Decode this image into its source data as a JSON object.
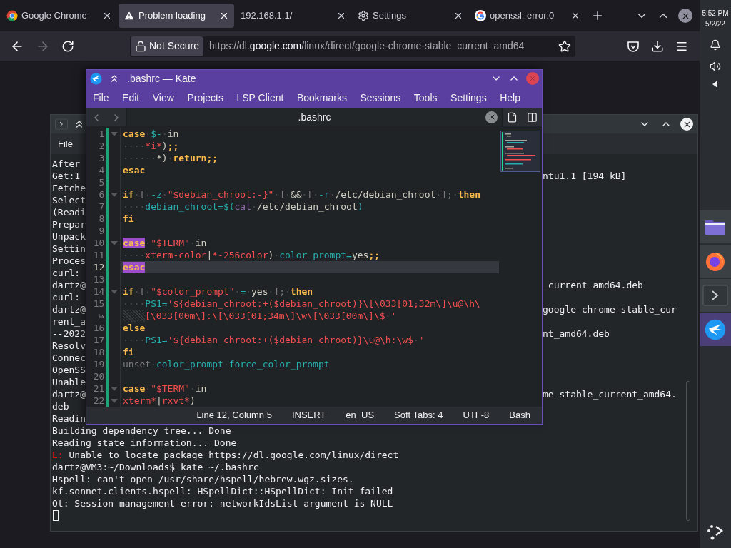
{
  "browser": {
    "tabs": [
      {
        "label": "Google Chrome",
        "kind": "chrome",
        "selected": false
      },
      {
        "label": "Problem loading",
        "kind": "warning",
        "selected": true
      },
      {
        "label": "192.168.1.1/",
        "kind": "plain",
        "selected": false
      },
      {
        "label": "Settings",
        "kind": "gear",
        "selected": false
      },
      {
        "label": "openssl: error:0",
        "kind": "google",
        "selected": false
      }
    ],
    "security": "Not Secure",
    "url": {
      "prefix": "https://dl.",
      "domain": "google.com",
      "rest": "/linux/direct/google-chrome-stable_current_amd64"
    }
  },
  "clock": {
    "time": "5:52 PM",
    "date": "5/2/22"
  },
  "terminal": {
    "menu": [
      "File"
    ],
    "lines": [
      {
        "left": "After"
      },
      {
        "left": "Get:1",
        "right": "ntu1.1 [194 kB]"
      },
      {
        "left": "Fetche"
      },
      {
        "left": "Select"
      },
      {
        "left": "(Readi"
      },
      {
        "left": "Prepar"
      },
      {
        "left": "Unpack"
      },
      {
        "left": "Settin"
      },
      {
        "left": "Proces"
      },
      {
        "left": "curl:"
      },
      {
        "left": "dartz@",
        "right": "_current_amd64.deb"
      },
      {
        "left": "curl:"
      },
      {
        "left": "dartz@",
        "right": "google-chrome-stable_cur"
      },
      {
        "left": "rent_a"
      },
      {
        "left": "--2022",
        "right": "nt_amd64.deb"
      },
      {
        "left": "Resolv"
      },
      {
        "left": "Connec"
      },
      {
        "left": "OpenSS"
      },
      {
        "left": "Unable"
      },
      {
        "left": "dartz@",
        "right": "me-stable_current_amd64."
      },
      {
        "left": "deb"
      },
      {
        "left": "Readin"
      },
      {
        "left": "Building dependency tree... Done"
      },
      {
        "left": "Reading state information... Done"
      },
      {
        "prefix": "E:",
        "left": " Unable to locate package https://dl.google.com/linux/direct"
      },
      {
        "left": "dartz@VM3:~/Downloads$ kate ~/.bashrc"
      },
      {
        "left": "Hspell: can't open /usr/share/hspell/hebrew.wgz.sizes."
      },
      {
        "left": "kf.sonnet.clients.hspell: HSpellDict::HSpellDict: Init failed"
      },
      {
        "left": "Qt: Session management error: networkIdsList argument is NULL"
      }
    ]
  },
  "kate": {
    "title": ".bashrc — Kate",
    "menu": [
      "File",
      "Edit",
      "View",
      "Projects",
      "LSP Client",
      "Bookmarks",
      "Sessions",
      "Tools",
      "Settings",
      "Help"
    ],
    "tab": ".bashrc",
    "lines": [
      {
        "kind": "line",
        "number": "1",
        "fold": true,
        "current": false,
        "tokens": [
          {
            "kind": "kw",
            "text": "case"
          },
          {
            "kind": "ws",
            "text": "·"
          },
          {
            "kind": "var",
            "text": "$-"
          },
          {
            "kind": "ws",
            "text": "·"
          },
          {
            "kind": "plain",
            "text": "in"
          }
        ]
      },
      {
        "kind": "line",
        "number": "2",
        "fold": false,
        "current": false,
        "tokens": [
          {
            "kind": "ws",
            "text": "····"
          },
          {
            "kind": "str",
            "text": "*i*"
          },
          {
            "kind": "plain",
            "text": ")"
          },
          {
            "kind": "kw",
            "text": ";;"
          }
        ]
      },
      {
        "kind": "line",
        "number": "3",
        "fold": false,
        "current": false,
        "tokens": [
          {
            "kind": "ws",
            "text": "······"
          },
          {
            "kind": "plain",
            "text": "*)"
          },
          {
            "kind": "ws",
            "text": "·"
          },
          {
            "kind": "kw",
            "text": "return;;"
          }
        ]
      },
      {
        "kind": "line",
        "number": "4",
        "fold": false,
        "current": false,
        "tokens": [
          {
            "kind": "kw",
            "text": "esac"
          }
        ]
      },
      {
        "kind": "line",
        "number": "5",
        "fold": false,
        "current": false
      },
      {
        "kind": "line",
        "number": "6",
        "fold": true,
        "current": false,
        "tokens": [
          {
            "kind": "kw",
            "text": "if"
          },
          {
            "kind": "ws",
            "text": "·"
          },
          {
            "kind": "dim",
            "text": "["
          },
          {
            "kind": "ws",
            "text": "·"
          },
          {
            "kind": "var",
            "text": "-z"
          },
          {
            "kind": "ws",
            "text": "·"
          },
          {
            "kind": "str",
            "text": "\"$debian_chroot:-}\""
          },
          {
            "kind": "ws",
            "text": "·"
          },
          {
            "kind": "dim",
            "text": "]"
          },
          {
            "kind": "ws",
            "text": "·"
          },
          {
            "kind": "plain",
            "text": "&&"
          },
          {
            "kind": "ws",
            "text": "·"
          },
          {
            "kind": "dim",
            "text": "["
          },
          {
            "kind": "ws",
            "text": "·"
          },
          {
            "kind": "var",
            "text": "-r"
          },
          {
            "kind": "ws",
            "text": "·"
          },
          {
            "kind": "plain",
            "text": "/etc/debian_chroot"
          },
          {
            "kind": "ws",
            "text": "·"
          },
          {
            "kind": "dim",
            "text": "];"
          },
          {
            "kind": "ws",
            "text": "·"
          },
          {
            "kind": "kw",
            "text": "then"
          }
        ]
      },
      {
        "kind": "line",
        "number": "7",
        "fold": false,
        "current": false,
        "tokens": [
          {
            "kind": "ws",
            "text": "····"
          },
          {
            "kind": "var",
            "text": "debian_chroot=$("
          },
          {
            "kind": "builtin",
            "text": "cat"
          },
          {
            "kind": "ws",
            "text": "·"
          },
          {
            "kind": "plain",
            "text": "/etc/debian_chroot"
          },
          {
            "kind": "var",
            "text": ")"
          }
        ]
      },
      {
        "kind": "line",
        "number": "8",
        "fold": false,
        "current": false,
        "tokens": [
          {
            "kind": "kw",
            "text": "fi"
          }
        ]
      },
      {
        "kind": "line",
        "number": "9",
        "fold": false,
        "current": false
      },
      {
        "kind": "line",
        "number": "10",
        "fold": true,
        "current": false,
        "tokens": [
          {
            "kind": "match",
            "text": "case"
          },
          {
            "kind": "ws",
            "text": "·"
          },
          {
            "kind": "str",
            "text": "\"$TERM\""
          },
          {
            "kind": "ws",
            "text": "·"
          },
          {
            "kind": "plain",
            "text": "in"
          }
        ]
      },
      {
        "kind": "line",
        "number": "11",
        "fold": false,
        "current": false,
        "tokens": [
          {
            "kind": "ws",
            "text": "····"
          },
          {
            "kind": "str",
            "text": "xterm-color"
          },
          {
            "kind": "plain",
            "text": "|"
          },
          {
            "kind": "str",
            "text": "*-256color"
          },
          {
            "kind": "plain",
            "text": ")"
          },
          {
            "kind": "ws",
            "text": "·"
          },
          {
            "kind": "var",
            "text": "color_prompt="
          },
          {
            "kind": "plain",
            "text": "yes"
          },
          {
            "kind": "kw",
            "text": ";;"
          }
        ]
      },
      {
        "kind": "line",
        "number": "12",
        "fold": false,
        "current": true,
        "tokens": [
          {
            "kind": "match",
            "text": "esac"
          }
        ]
      },
      {
        "kind": "line",
        "number": "13",
        "fold": false,
        "current": false
      },
      {
        "kind": "line",
        "number": "14",
        "fold": true,
        "current": false,
        "tokens": [
          {
            "kind": "kw",
            "text": "if"
          },
          {
            "kind": "ws",
            "text": "·"
          },
          {
            "kind": "dim",
            "text": "["
          },
          {
            "kind": "ws",
            "text": "·"
          },
          {
            "kind": "str",
            "text": "\"$color_prompt\""
          },
          {
            "kind": "ws",
            "text": "·"
          },
          {
            "kind": "var",
            "text": "="
          },
          {
            "kind": "ws",
            "text": "·"
          },
          {
            "kind": "plain",
            "text": "yes"
          },
          {
            "kind": "ws",
            "text": "·"
          },
          {
            "kind": "dim",
            "text": "];"
          },
          {
            "kind": "ws",
            "text": "·"
          },
          {
            "kind": "kw",
            "text": "then"
          }
        ]
      },
      {
        "kind": "line",
        "number": "15",
        "fold": false,
        "current": false,
        "tokens": [
          {
            "kind": "ws",
            "text": "····"
          },
          {
            "kind": "var",
            "text": "PS1="
          },
          {
            "kind": "str",
            "text": "'${debian_chroot:+($debian_chroot)}\\[\\033[01;32m\\]\\u@\\h\\"
          }
        ]
      },
      {
        "kind": "wrap",
        "fold": false,
        "current": false,
        "tokens": [
          {
            "kind": "str",
            "text": "[\\033[00m\\]:\\[\\033[01;34m\\]\\w\\[\\033[00m\\]\\$"
          },
          {
            "kind": "ws",
            "text": "·"
          },
          {
            "kind": "str",
            "text": "'"
          }
        ]
      },
      {
        "kind": "line",
        "number": "16",
        "fold": false,
        "current": false,
        "tokens": [
          {
            "kind": "kw",
            "text": "else"
          }
        ]
      },
      {
        "kind": "line",
        "number": "17",
        "fold": false,
        "current": false,
        "tokens": [
          {
            "kind": "ws",
            "text": "····"
          },
          {
            "kind": "var",
            "text": "PS1="
          },
          {
            "kind": "str",
            "text": "'${debian_chroot:+($debian_chroot)}\\u@\\h:\\w$"
          },
          {
            "kind": "ws",
            "text": "·"
          },
          {
            "kind": "str",
            "text": "'"
          }
        ]
      },
      {
        "kind": "line",
        "number": "18",
        "fold": false,
        "current": false,
        "tokens": [
          {
            "kind": "kw",
            "text": "fi"
          }
        ]
      },
      {
        "kind": "line",
        "number": "19",
        "fold": false,
        "current": false,
        "tokens": [
          {
            "kind": "dim",
            "text": "unset"
          },
          {
            "kind": "ws",
            "text": "·"
          },
          {
            "kind": "var",
            "text": "color_prompt"
          },
          {
            "kind": "ws",
            "text": "·"
          },
          {
            "kind": "var",
            "text": "force_color_prompt"
          }
        ]
      },
      {
        "kind": "line",
        "number": "20",
        "fold": false,
        "current": false
      },
      {
        "kind": "line",
        "number": "21",
        "fold": true,
        "current": false,
        "tokens": [
          {
            "kind": "kw",
            "text": "case"
          },
          {
            "kind": "ws",
            "text": "·"
          },
          {
            "kind": "str",
            "text": "\"$TERM\""
          },
          {
            "kind": "ws",
            "text": "·"
          },
          {
            "kind": "plain",
            "text": "in"
          }
        ]
      },
      {
        "kind": "line",
        "number": "22",
        "fold": true,
        "current": false,
        "tokens": [
          {
            "kind": "str",
            "text": "xterm*"
          },
          {
            "kind": "plain",
            "text": "|"
          },
          {
            "kind": "str",
            "text": "rxvt*"
          },
          {
            "kind": "plain",
            "text": ")"
          }
        ]
      }
    ],
    "status": [
      "Line 12, Column 5",
      "INSERT",
      "en_US",
      "Soft Tabs: 4",
      "UTF-8",
      "Bash"
    ]
  }
}
